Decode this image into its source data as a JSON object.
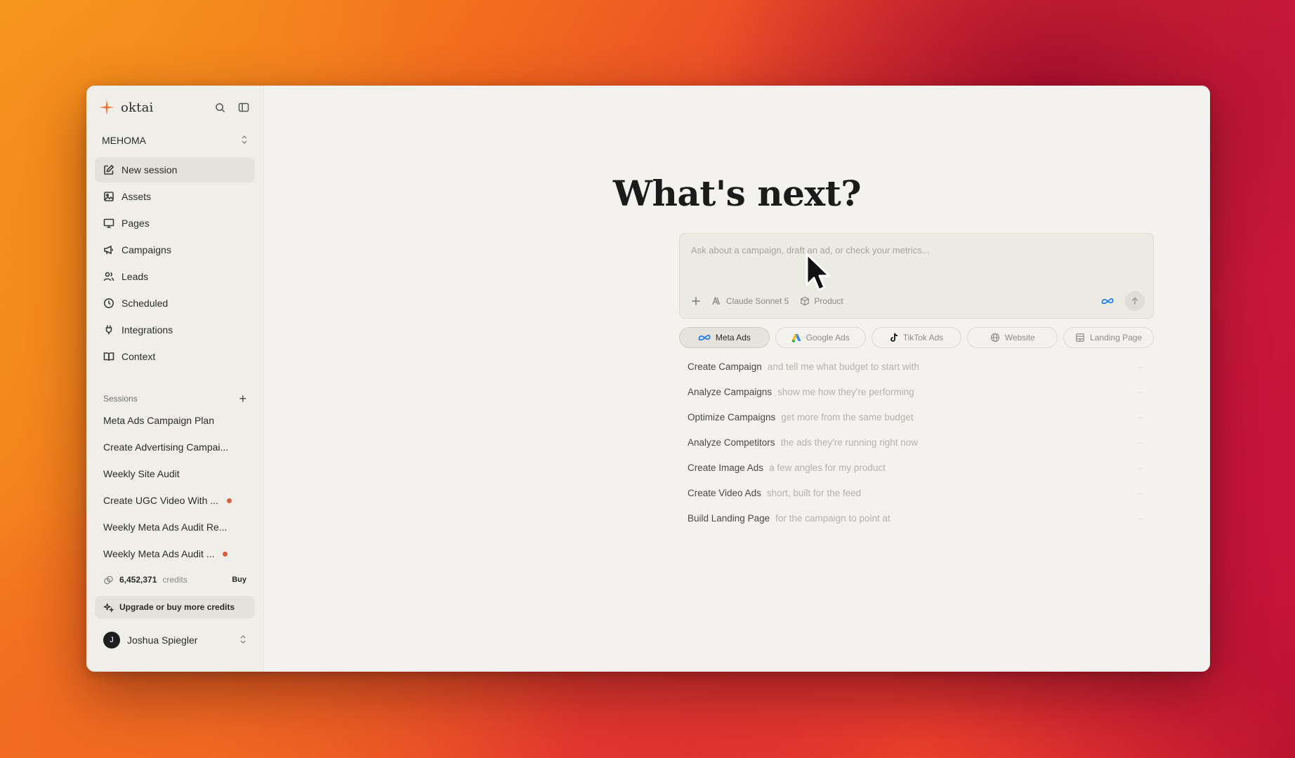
{
  "app": {
    "name": "oktai",
    "workspace": "MEHOMA"
  },
  "nav": [
    {
      "label": "New session",
      "icon": "edit-icon"
    },
    {
      "label": "Assets",
      "icon": "image-icon"
    },
    {
      "label": "Pages",
      "icon": "monitor-icon"
    },
    {
      "label": "Campaigns",
      "icon": "megaphone-icon"
    },
    {
      "label": "Leads",
      "icon": "users-icon"
    },
    {
      "label": "Scheduled",
      "icon": "clock-icon"
    },
    {
      "label": "Integrations",
      "icon": "plug-icon"
    },
    {
      "label": "Context",
      "icon": "book-icon"
    }
  ],
  "sessions": {
    "heading": "Sessions",
    "items": [
      {
        "label": "Meta Ads Campaign Plan",
        "dot": false
      },
      {
        "label": "Create Advertising Campai...",
        "dot": false
      },
      {
        "label": "Weekly Site Audit",
        "dot": false
      },
      {
        "label": "Create UGC Video With ...",
        "dot": true
      },
      {
        "label": "Weekly Meta Ads Audit Re...",
        "dot": false
      },
      {
        "label": "Weekly Meta Ads Audit ...",
        "dot": true
      }
    ]
  },
  "credits": {
    "amount": "6,452,371",
    "label": "credits",
    "buy": "Buy"
  },
  "upgrade_label": "Upgrade or buy more credits",
  "user": {
    "initial": "J",
    "name": "Joshua Spiegler"
  },
  "main": {
    "title": "What's next?",
    "composer": {
      "placeholder": "Ask about a campaign, draft an ad, or check your metrics...",
      "model": "Claude Sonnet 5",
      "context": "Product"
    },
    "chips": [
      {
        "label": "Meta Ads",
        "active": true
      },
      {
        "label": "Google Ads",
        "active": false
      },
      {
        "label": "TikTok Ads",
        "active": false
      },
      {
        "label": "Website",
        "active": false
      },
      {
        "label": "Landing Page",
        "active": false
      }
    ],
    "suggestions": [
      {
        "title": "Create Campaign",
        "desc": "and tell me what budget to start with"
      },
      {
        "title": "Analyze Campaigns",
        "desc": "show me how they're performing"
      },
      {
        "title": "Optimize Campaigns",
        "desc": "get more from the same budget"
      },
      {
        "title": "Analyze Competitors",
        "desc": "the ads they're running right now"
      },
      {
        "title": "Create Image Ads",
        "desc": "a few angles for my product"
      },
      {
        "title": "Create Video Ads",
        "desc": "short, built for the feed"
      },
      {
        "title": "Build Landing Page",
        "desc": "for the campaign to point at"
      }
    ]
  },
  "colors": {
    "accent": "#e8763a",
    "session_dot": "#d9603f",
    "meta_blue": "#1877f2"
  }
}
